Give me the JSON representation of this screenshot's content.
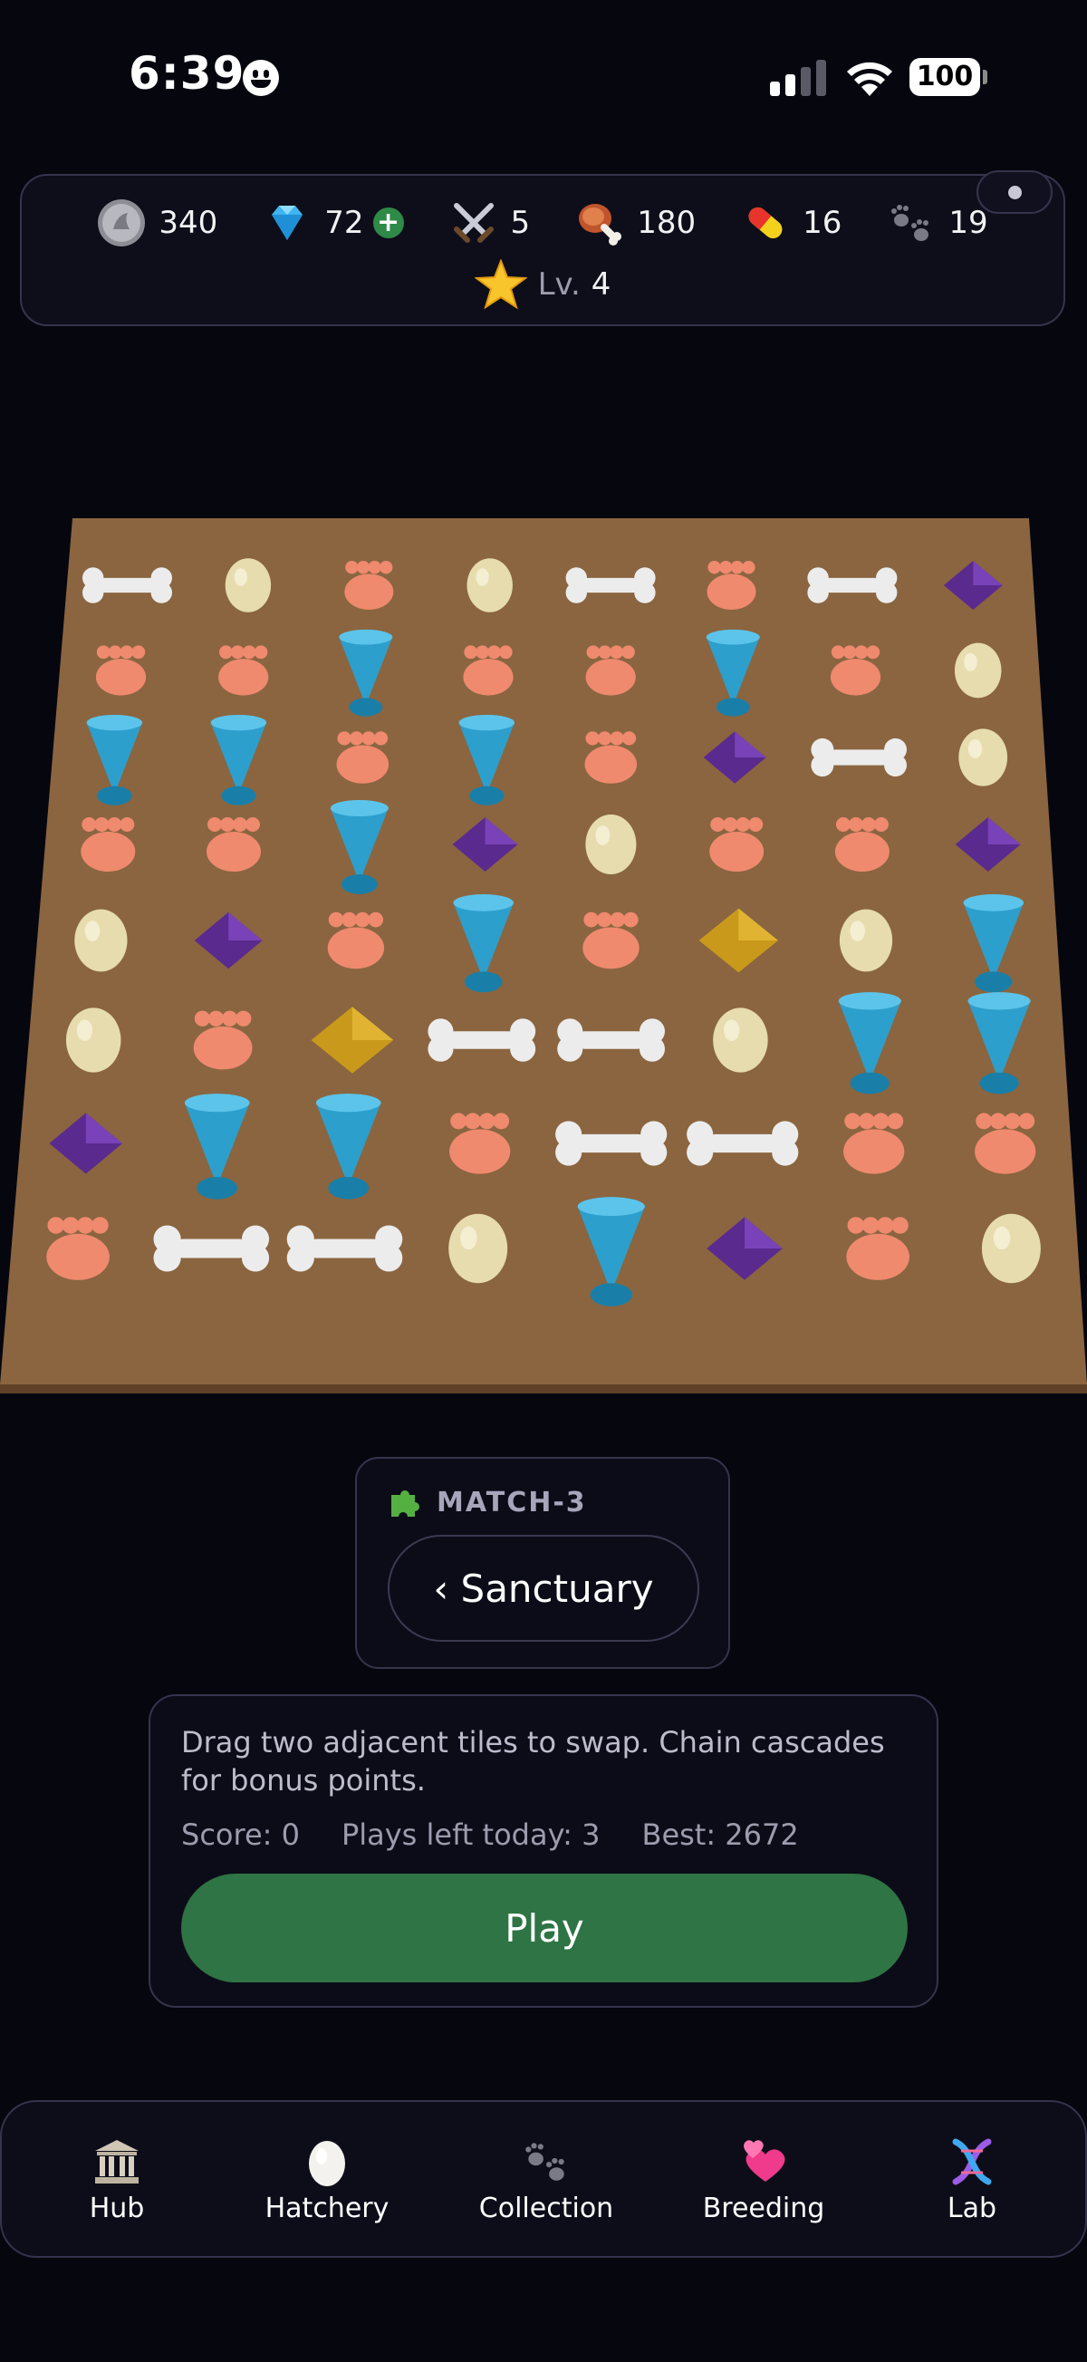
{
  "status_bar": {
    "time": "6:39",
    "battery": "100"
  },
  "resources": {
    "coins": "340",
    "gems": "72",
    "gem_add": "+",
    "swords": "5",
    "meat": "180",
    "pills": "16",
    "paws": "19",
    "level_label": "Lv.",
    "level_value": "4"
  },
  "board": {
    "rows": 8,
    "cols": 8,
    "tiles": [
      [
        "bone",
        "egg",
        "paw",
        "egg",
        "bone",
        "paw",
        "bone",
        "crystal"
      ],
      [
        "paw",
        "paw",
        "cone",
        "paw",
        "paw",
        "cone",
        "paw",
        "egg"
      ],
      [
        "cone",
        "cone",
        "paw",
        "cone",
        "paw",
        "crystal",
        "bone",
        "egg"
      ],
      [
        "paw",
        "paw",
        "cone",
        "crystal",
        "egg",
        "paw",
        "paw",
        "crystal"
      ],
      [
        "egg",
        "crystal",
        "paw",
        "cone",
        "paw",
        "gold",
        "egg",
        "cone"
      ],
      [
        "egg",
        "paw",
        "gold",
        "bone",
        "bone",
        "egg",
        "cone",
        "cone"
      ],
      [
        "crystal",
        "cone",
        "cone",
        "paw",
        "bone",
        "bone",
        "paw",
        "paw"
      ],
      [
        "paw",
        "bone",
        "bone",
        "egg",
        "cone",
        "crystal",
        "paw",
        "egg"
      ]
    ],
    "colors": {
      "surface": "#8a6540",
      "edge": "#5e4126",
      "paw": "#ef8a6e",
      "egg": "#e6dcae",
      "bone": "#ececec",
      "cone": "#2d9fcc",
      "crystal": "#5a2a8e",
      "gold": "#c9991b"
    }
  },
  "game": {
    "tag_label": "MATCH-3",
    "back_label": "‹ Sanctuary",
    "description": "Drag two adjacent tiles to swap. Chain cascades for bonus points.",
    "score": "Score: 0",
    "plays_left": "Plays left today: 3",
    "best": "Best: 2672",
    "play_label": "Play"
  },
  "nav": {
    "hub": "Hub",
    "hatchery": "Hatchery",
    "collection": "Collection",
    "breeding": "Breeding",
    "lab": "Lab"
  }
}
